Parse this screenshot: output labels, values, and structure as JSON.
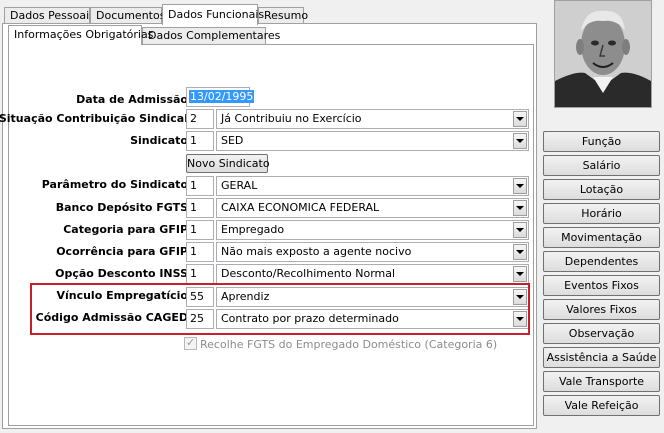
{
  "outer_tabs": [
    {
      "label": "Dados Pessoais",
      "active": false
    },
    {
      "label": "Documentos",
      "active": false
    },
    {
      "label": "Dados Funcionais",
      "active": true
    },
    {
      "label": "Resumo",
      "active": false
    }
  ],
  "inner_tabs": [
    {
      "label": "Informações Obrigatórias",
      "active": true
    },
    {
      "label": "Dados Complementares",
      "active": false
    }
  ],
  "form": {
    "data_admissao": {
      "label": "Data de Admissão",
      "value": "13/02/1995"
    },
    "situacao_contribuicao": {
      "label": "Situação Contribuição Sindical",
      "code": "2",
      "value": "Já Contribuiu no Exercício"
    },
    "sindicato": {
      "label": "Sindicato",
      "code": "1",
      "value": "SED"
    },
    "novo_sindicato_button": "Novo Sindicato",
    "parametro_sindicato": {
      "label": "Parâmetro do Sindicato",
      "code": "1",
      "value": "GERAL"
    },
    "banco_fgts": {
      "label": "Banco Depósito FGTS",
      "code": "1",
      "value": "CAIXA ECONOMICA FEDERAL"
    },
    "categoria_gfip": {
      "label": "Categoria para GFIP",
      "code": "1",
      "value": "Empregado"
    },
    "ocorrencia_gfip": {
      "label": "Ocorrência para GFIP",
      "code": "1",
      "value": "Não mais exposto a agente nocivo"
    },
    "opcao_inss": {
      "label": "Opção Desconto INSS",
      "code": "1",
      "value": "Desconto/Recolhimento Normal"
    },
    "vinculo": {
      "label": "Vínculo Empregatício",
      "code": "55",
      "value": "Aprendiz"
    },
    "caged": {
      "label": "Código Admissão CAGED",
      "code": "25",
      "value": "Contrato por prazo determinado"
    },
    "recolhe_fgts_checkbox": {
      "label": "Recolhe FGTS do Empregado Doméstico (Categoria 6)",
      "checked": true,
      "disabled": true
    }
  },
  "side_buttons": [
    "Função",
    "Salário",
    "Lotação",
    "Horário",
    "Movimentação",
    "Dependentes",
    "Eventos Fixos",
    "Valores Fixos",
    "Observação",
    "Assistência a Saúde",
    "Vale Transporte",
    "Vale Refeição"
  ],
  "colors": {
    "highlight_border": "#c8202a",
    "selection": "#3399ff"
  }
}
